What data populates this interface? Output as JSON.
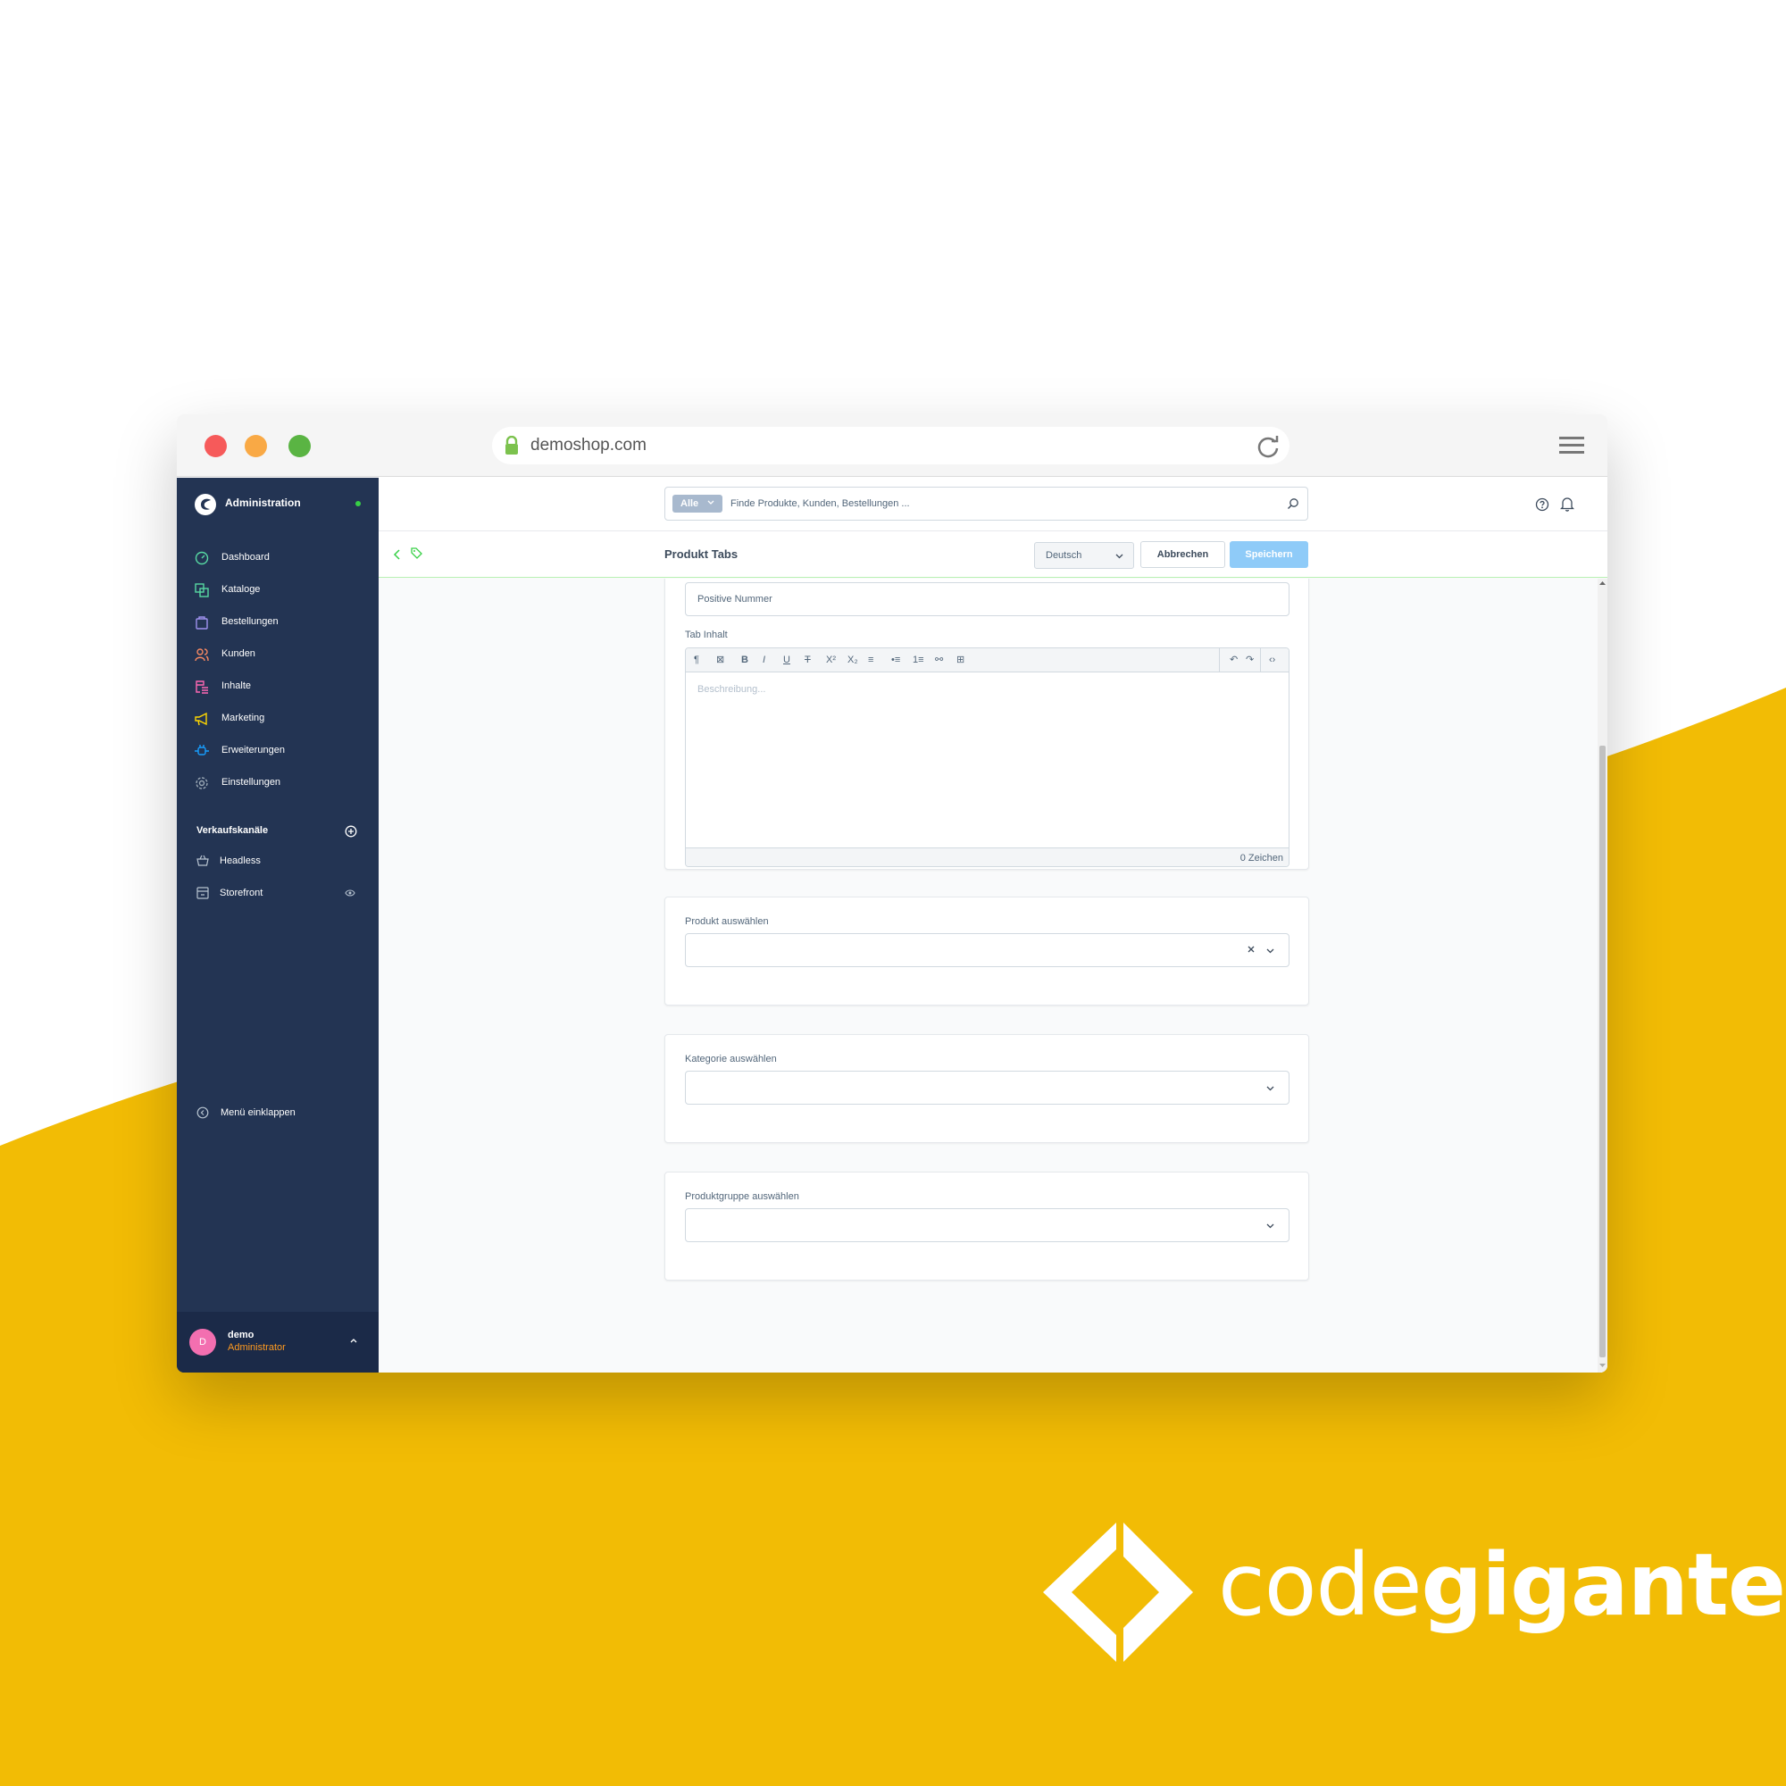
{
  "colors": {
    "accent": "#189eff",
    "sidebar": "#233453",
    "brand_yellow": "#f2bc05",
    "save_button": "#8fcbf8"
  },
  "browser": {
    "url": "demoshop.com"
  },
  "sidebar": {
    "brand": "Administration",
    "items": [
      {
        "label": "Dashboard",
        "icon": "dashboard-icon",
        "color": "#57d9a3"
      },
      {
        "label": "Kataloge",
        "icon": "catalog-icon",
        "color": "#57d9a3"
      },
      {
        "label": "Bestellungen",
        "icon": "orders-icon",
        "color": "#a092f0"
      },
      {
        "label": "Kunden",
        "icon": "customers-icon",
        "color": "#f88962"
      },
      {
        "label": "Inhalte",
        "icon": "content-icon",
        "color": "#ff68b4"
      },
      {
        "label": "Marketing",
        "icon": "marketing-icon",
        "color": "#ffd700"
      },
      {
        "label": "Erweiterungen",
        "icon": "extensions-icon",
        "color": "#189eff"
      },
      {
        "label": "Einstellungen",
        "icon": "settings-icon",
        "color": "#9aa8b5"
      }
    ],
    "channels_title": "Verkaufskanäle",
    "channels": [
      {
        "label": "Headless",
        "icon": "basket-icon"
      },
      {
        "label": "Storefront",
        "icon": "storefront-icon"
      }
    ],
    "collapse_label": "Menü einklappen",
    "user": {
      "initial": "D",
      "name": "demo",
      "role": "Administrator"
    }
  },
  "topbar": {
    "search_filter": "Alle",
    "search_placeholder": "Finde Produkte, Kunden, Bestellungen ..."
  },
  "smartbar": {
    "title": "Produkt Tabs",
    "language": "Deutsch",
    "cancel_label": "Abbrechen",
    "save_label": "Speichern"
  },
  "form": {
    "position_placeholder": "Positive Nummer",
    "tab_content_label": "Tab Inhalt",
    "editor_placeholder": "Beschreibung...",
    "char_count": "0 Zeichen",
    "product_label": "Produkt auswählen",
    "category_label": "Kategorie auswählen",
    "product_group_label": "Produktgruppe auswählen"
  },
  "brand_logo": {
    "light": "code",
    "bold": "giganten"
  }
}
